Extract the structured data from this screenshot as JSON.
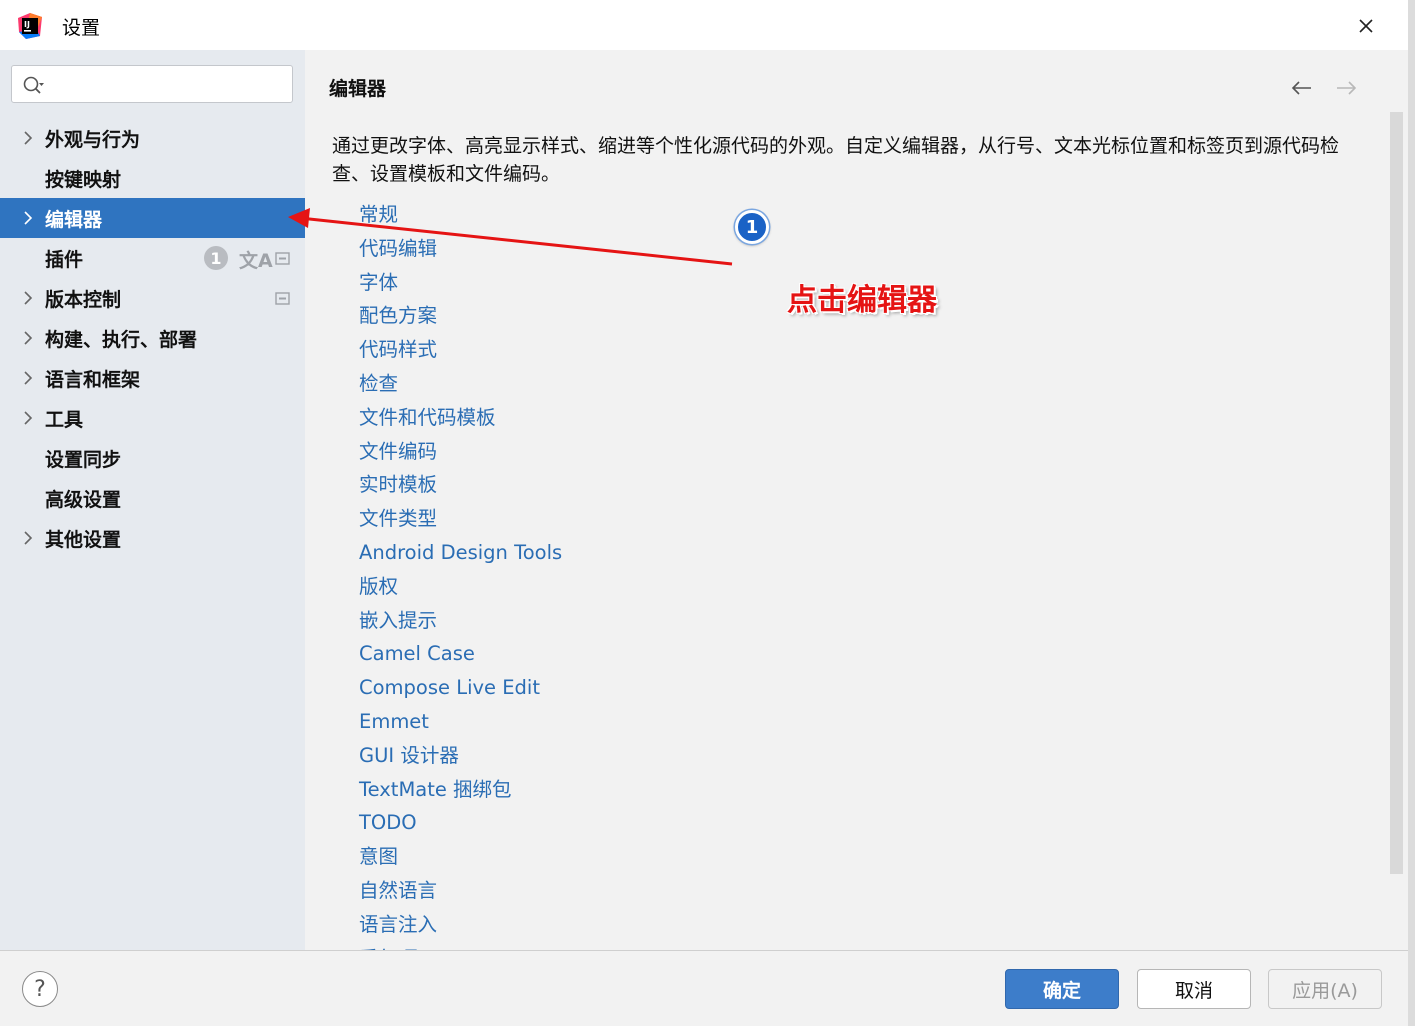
{
  "window": {
    "title": "设置"
  },
  "search": {
    "placeholder": ""
  },
  "sidebar": {
    "items": [
      {
        "label": "外观与行为",
        "expandable": true,
        "selected": false
      },
      {
        "label": "按键映射",
        "expandable": false,
        "selected": false
      },
      {
        "label": "编辑器",
        "expandable": true,
        "selected": true
      },
      {
        "label": "插件",
        "expandable": false,
        "selected": false,
        "badge": "1"
      },
      {
        "label": "版本控制",
        "expandable": true,
        "selected": false
      },
      {
        "label": "构建、执行、部署",
        "expandable": true,
        "selected": false
      },
      {
        "label": "语言和框架",
        "expandable": true,
        "selected": false
      },
      {
        "label": "工具",
        "expandable": true,
        "selected": false
      },
      {
        "label": "设置同步",
        "expandable": false,
        "selected": false
      },
      {
        "label": "高级设置",
        "expandable": false,
        "selected": false
      },
      {
        "label": "其他设置",
        "expandable": true,
        "selected": false
      }
    ],
    "plugin_translate_glyph": "文A"
  },
  "main": {
    "title": "编辑器",
    "description": "通过更改字体、高亮显示样式、缩进等个性化源代码的外观。自定义编辑器，从行号、文本光标位置和标签页到源代码检查、设置模板和文件编码。",
    "links": [
      "常规",
      "代码编辑",
      "字体",
      "配色方案",
      "代码样式",
      "检查",
      "文件和代码模板",
      "文件编码",
      "实时模板",
      "文件类型",
      "Android Design Tools",
      "版权",
      "嵌入提示",
      "Camel Case",
      "Compose Live Edit",
      "Emmet",
      "GUI 设计器",
      "TextMate 捆绑包",
      "TODO",
      "意图",
      "自然语言",
      "语言注入",
      "重复项"
    ]
  },
  "footer": {
    "help": "?",
    "ok": "确定",
    "cancel": "取消",
    "apply": "应用(A)"
  },
  "annotation": {
    "step": "1",
    "text": "点击编辑器"
  },
  "colors": {
    "accent": "#2f74c0",
    "link": "#2a6db4",
    "annotation_red": "#e51414",
    "step_blue": "#1a62c6"
  }
}
